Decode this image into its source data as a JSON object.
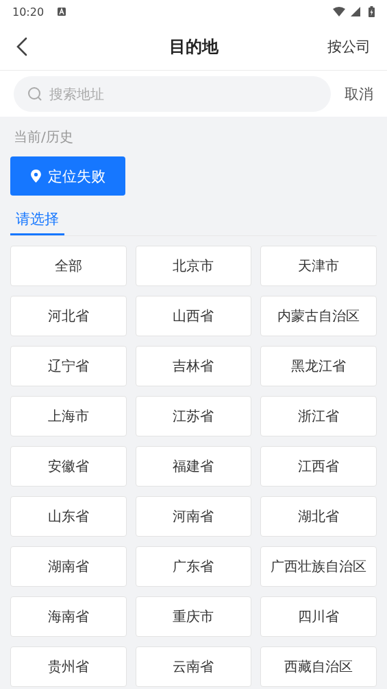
{
  "status_bar": {
    "time": "10:20"
  },
  "header": {
    "title": "目的地",
    "action": "按公司"
  },
  "search": {
    "placeholder": "搜索地址",
    "cancel": "取消"
  },
  "history": {
    "label": "当前/历史",
    "location_button": "定位失败"
  },
  "tabs": [
    {
      "label": "请选择",
      "selected": true
    }
  ],
  "regions": [
    "全部",
    "北京市",
    "天津市",
    "河北省",
    "山西省",
    "内蒙古自治区",
    "辽宁省",
    "吉林省",
    "黑龙江省",
    "上海市",
    "江苏省",
    "浙江省",
    "安徽省",
    "福建省",
    "江西省",
    "山东省",
    "河南省",
    "湖北省",
    "湖南省",
    "广东省",
    "广西壮族自治区",
    "海南省",
    "重庆市",
    "四川省",
    "贵州省",
    "云南省",
    "西藏自治区"
  ]
}
